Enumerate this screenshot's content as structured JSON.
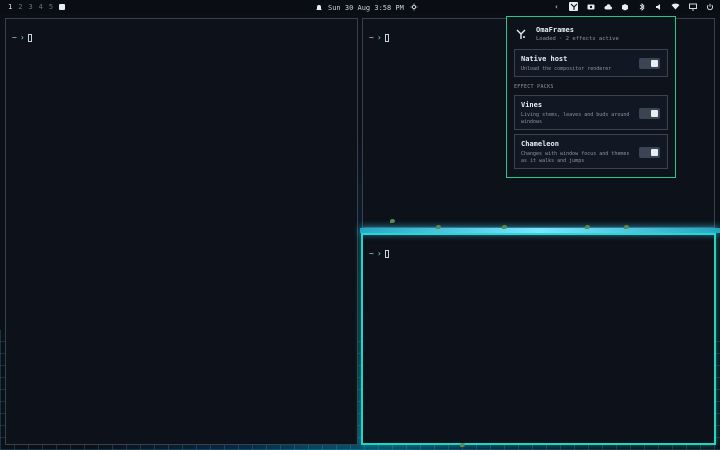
{
  "topbar": {
    "workspaces": [
      "1",
      "2",
      "3",
      "4",
      "5"
    ],
    "active_workspace": "1",
    "datetime": "Sun 30 Aug 3:58 PM",
    "tray_icons": [
      "chevron-left-icon",
      "omaframes-icon",
      "camera-icon",
      "cloud-icon",
      "box-icon",
      "bluetooth-icon",
      "speaker-icon",
      "wifi-icon",
      "monitor-icon",
      "power-icon"
    ]
  },
  "terminals": [
    {
      "prompt_symbol": "~",
      "arrow": "›"
    },
    {
      "prompt_symbol": "~",
      "arrow": "›"
    },
    {
      "prompt_symbol": "~",
      "arrow": "›"
    }
  ],
  "panel": {
    "title": "OmaFrames",
    "subtitle": "Loaded · 2 effects active",
    "native": {
      "title": "Native host",
      "desc": "Unload the compositor renderer",
      "enabled": true
    },
    "section_label": "EFFECT PACKS",
    "packs": [
      {
        "title": "Vines",
        "desc": "Living stems, leaves and buds around windows",
        "enabled": true
      },
      {
        "title": "Chameleon",
        "desc": "Changes with window focus and themes as it walks and jumps",
        "enabled": true
      }
    ]
  },
  "colors": {
    "accent": "#1fd6c0",
    "panel_border": "#23c98b",
    "background": "#0b0f17"
  }
}
